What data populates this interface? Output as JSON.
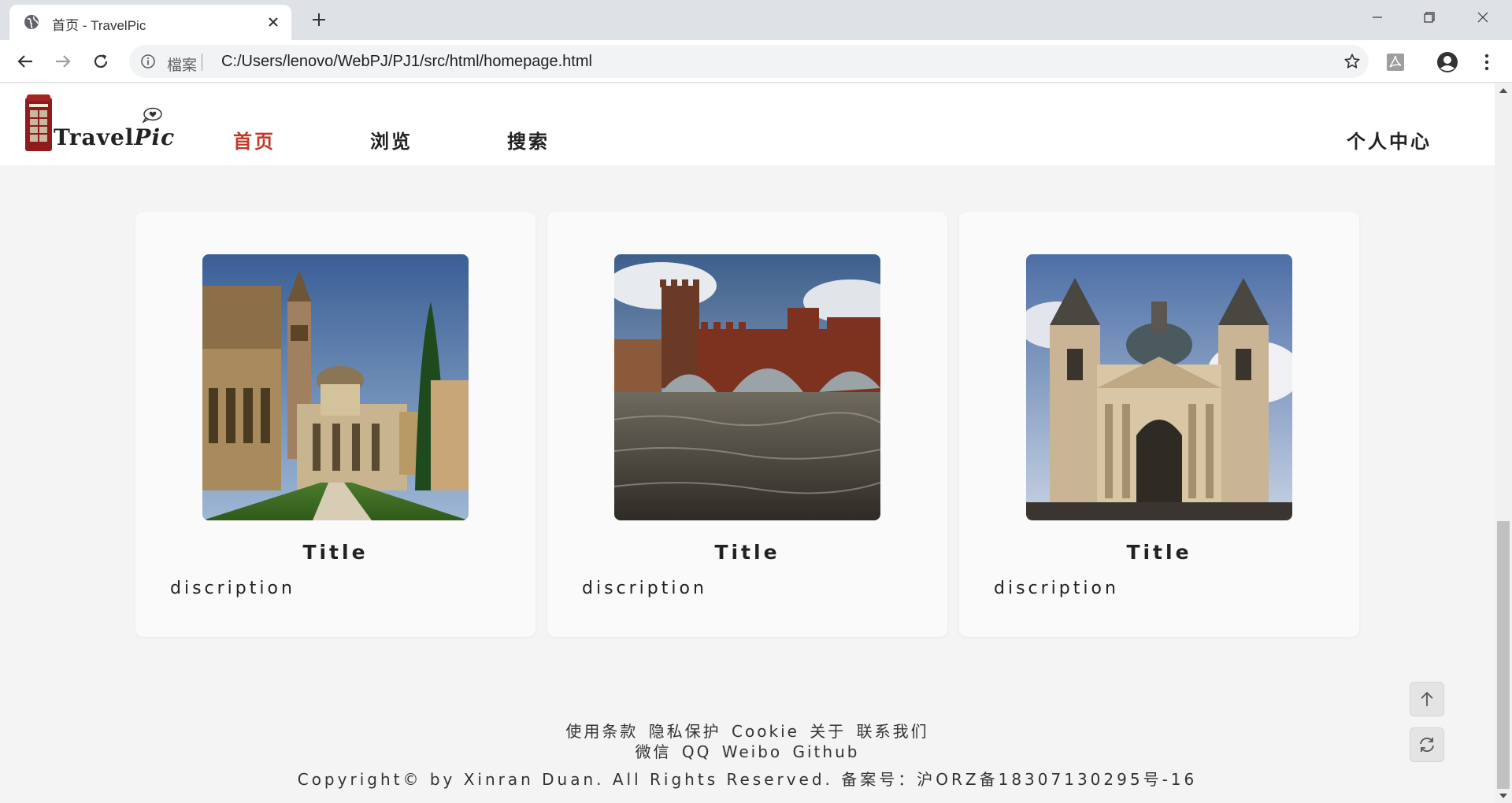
{
  "browser": {
    "tab_title": "首页 - TravelPic",
    "omnibox_label": "檔案",
    "url": "C:/Users/lenovo/WebPJ/PJ1/src/html/homepage.html"
  },
  "header": {
    "logo_word1": "Travel",
    "logo_word2": "Pic",
    "nav": {
      "home": "首页",
      "browse": "浏览",
      "search": "搜索",
      "user": "个人中心"
    }
  },
  "cards": [
    {
      "title": "Title",
      "description": "discription",
      "photo": "basilica-courtyard-photo"
    },
    {
      "title": "Title",
      "description": "discription",
      "photo": "castle-bridge-river-photo"
    },
    {
      "title": "Title",
      "description": "discription",
      "photo": "domed-cathedral-photo"
    }
  ],
  "footer": {
    "links_row1": [
      "使用条款",
      "隐私保护",
      "Cookie",
      "关于",
      "联系我们"
    ],
    "links_row2": [
      "微信",
      "QQ",
      "Weibo",
      "Github"
    ],
    "copyright": "Copyright© by Xinran Duan. All Rights Reserved. 备案号：沪ORZ备18307130295号-16"
  },
  "colors": {
    "accent": "#c0392b",
    "page_bg": "#f4f4f4",
    "card_bg": "#fafafa"
  }
}
